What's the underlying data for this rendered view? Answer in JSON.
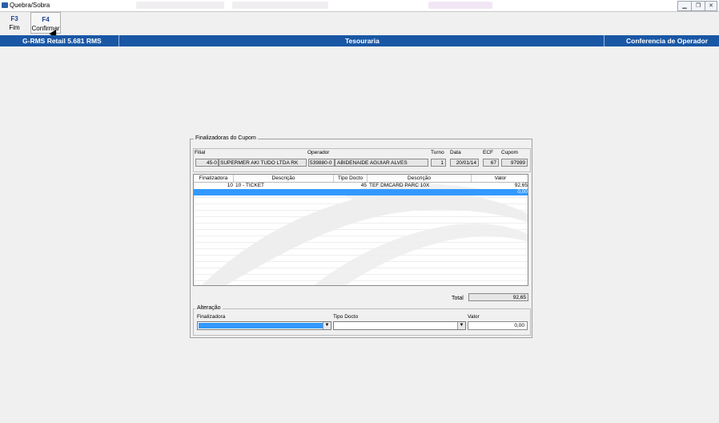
{
  "window": {
    "title": "Quebra/Sobra"
  },
  "toolbar": {
    "buttons": [
      {
        "key": "F3",
        "label": "Fim"
      },
      {
        "key": "F4",
        "label": "Confirmar"
      }
    ]
  },
  "status": {
    "left": "G-RMS Retail 5.681 RMS",
    "center": "Tesouraria",
    "right": "Conferencia de Operador"
  },
  "cupom": {
    "legend": "Finalizadoras do Cupom",
    "filial_label": "Filial",
    "filial_code": "45-0",
    "filial_name": "SUPERMER AKI TUDO LTDA RK",
    "operador_label": "Operador",
    "operador_code": "539880-0",
    "operador_name": "ABIDENAIDE AGUIAR ALVES",
    "turno_label": "Turno",
    "turno": "1",
    "data_label": "Data",
    "data": "20/01/14",
    "ecf_label": "ECF",
    "ecf": "67",
    "cupom_label": "Cupom",
    "cupom": "97999"
  },
  "grid": {
    "headers": [
      "Finalizadora",
      "Descrição",
      "Tipo Docto",
      "Descrição",
      "Valor"
    ],
    "rows": [
      {
        "finalizadora": "10",
        "descricao": "10 - TICKET",
        "tipo": "45",
        "descricao2": "TEF DMCARD PARC 10X",
        "valor": "92,65"
      },
      {
        "finalizadora": "",
        "descricao": "",
        "tipo": "",
        "descricao2": "",
        "valor": "0,00"
      }
    ]
  },
  "total": {
    "label": "Total",
    "value": "92,65"
  },
  "alteracao": {
    "legend": "Alteração",
    "finalizadora_label": "Finalizadora",
    "tipo_label": "Tipo Docto",
    "valor_label": "Valor",
    "valor": "0,00"
  },
  "icons": [
    "app-icon",
    "minimize-icon",
    "restore-icon",
    "close-icon",
    "dropdown-arrow-icon"
  ]
}
